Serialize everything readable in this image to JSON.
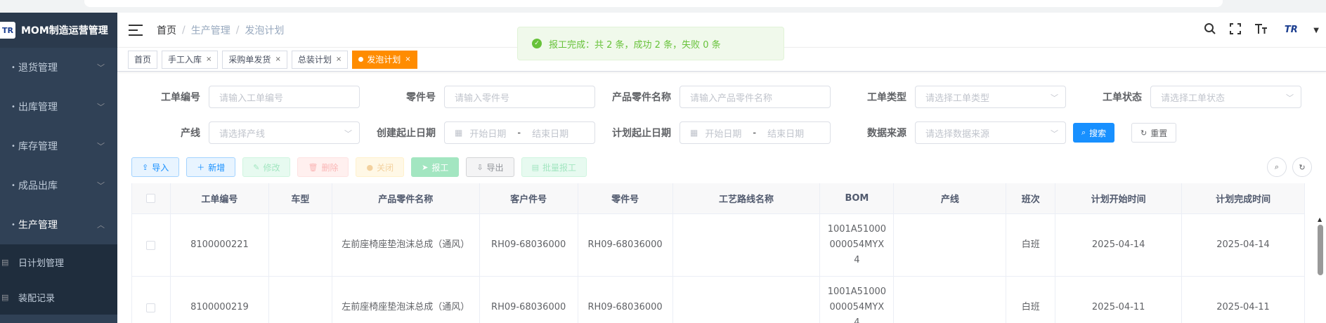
{
  "sidebar": {
    "logo_text": "TR",
    "title": "MOM制造运营管理",
    "menu": [
      {
        "label": "退货管理",
        "active": false
      },
      {
        "label": "出库管理",
        "active": false
      },
      {
        "label": "库存管理",
        "active": false
      },
      {
        "label": "成品出库",
        "active": false
      },
      {
        "label": "生产管理",
        "active": true
      }
    ],
    "submenu": [
      {
        "label": "日计划管理"
      },
      {
        "label": "装配记录"
      }
    ]
  },
  "navbar": {
    "breadcrumb": [
      "首页",
      "生产管理",
      "发泡计划"
    ],
    "logo_text": "TR"
  },
  "tags": [
    {
      "label": "首页",
      "closable": false,
      "active": false
    },
    {
      "label": "手工入库",
      "closable": true,
      "active": false
    },
    {
      "label": "采购单发货",
      "closable": true,
      "active": false
    },
    {
      "label": "总装计划",
      "closable": true,
      "active": false
    },
    {
      "label": "发泡计划",
      "closable": true,
      "active": true
    }
  ],
  "notification": {
    "text": "报工完成：共 2 条，成功 2 条，失败 0 条",
    "color": "#67c23a"
  },
  "form": {
    "work_order_no": {
      "label": "工单编号",
      "placeholder": "请输入工单编号"
    },
    "part_no": {
      "label": "零件号",
      "placeholder": "请输入零件号"
    },
    "product_part_name": {
      "label": "产品零件名称",
      "placeholder": "请输入产品零件名称"
    },
    "work_order_type": {
      "label": "工单类型",
      "placeholder": "请选择工单类型"
    },
    "work_order_status": {
      "label": "工单状态",
      "placeholder": "请选择工单状态"
    },
    "line": {
      "label": "产线",
      "placeholder": "请选择产线"
    },
    "create_date": {
      "label": "创建起止日期",
      "start": "开始日期",
      "end": "结束日期"
    },
    "plan_date": {
      "label": "计划起止日期",
      "start": "开始日期",
      "end": "结束日期"
    },
    "data_source": {
      "label": "数据来源",
      "placeholder": "请选择数据来源"
    },
    "search_label": "搜索",
    "reset_label": "重置"
  },
  "toolbar": {
    "import": "导入",
    "add": "新增",
    "edit": "修改",
    "delete": "删除",
    "close": "关闭",
    "report": "报工",
    "export": "导出",
    "batch_report": "批量报工"
  },
  "table": {
    "headers": [
      "工单编号",
      "车型",
      "产品零件名称",
      "客户件号",
      "零件号",
      "工艺路线名称",
      "BOM",
      "产线",
      "班次",
      "计划开始时间",
      "计划完成时间"
    ],
    "rows": [
      {
        "work_order_no": "8100000221",
        "model": "",
        "product_part_name": "左前座椅座垫泡沫总成（通风）",
        "customer_part_no": "RH09-68036000",
        "part_no": "RH09-68036000",
        "route_name": "",
        "bom": "1001A51000000054MYX4",
        "line": "",
        "shift": "白班",
        "plan_start": "2025-04-14",
        "plan_end": "2025-04-14"
      },
      {
        "work_order_no": "8100000219",
        "model": "",
        "product_part_name": "左前座椅座垫泡沫总成（通风）",
        "customer_part_no": "RH09-68036000",
        "part_no": "RH09-68036000",
        "route_name": "",
        "bom": "1001A51000000054MYX4",
        "line": "",
        "shift": "白班",
        "plan_start": "2025-04-11",
        "plan_end": "2025-04-11"
      }
    ]
  },
  "colors": {
    "sidebar_bg": "#304156",
    "primary": "#1890ff",
    "active_tag": "#ff8c00"
  }
}
